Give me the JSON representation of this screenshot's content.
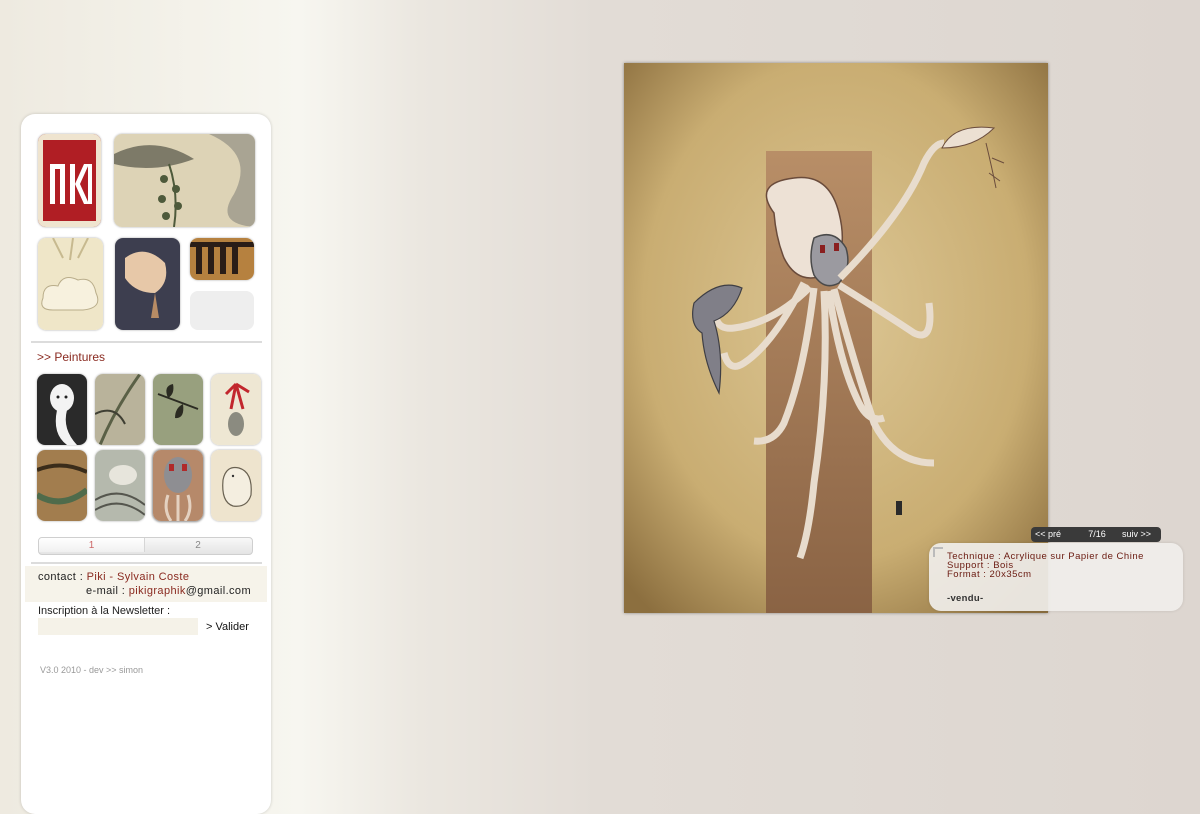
{
  "sidebar": {
    "section_link": ">> Peintures",
    "pagination": [
      "1",
      "2"
    ],
    "contact": {
      "label": "contact :",
      "name": "Piki - Sylvain Coste",
      "email_label": "e-mail :",
      "email_user": "pikigraphik",
      "email_domain": "@gmail.com"
    },
    "newsletter": {
      "label": "Inscription à la Newsletter :",
      "placeholder": "",
      "submit": "> Valider"
    },
    "footer": "V3.0 2010 - dev >> simon"
  },
  "viewer": {
    "prev": "<< pré",
    "counter": "7/16",
    "next": "suiv >>",
    "info": {
      "technique": "Technique : Acrylique sur Papier de Chine",
      "support": "Support : Bois",
      "format": "Format : 20x35cm",
      "status": "-vendu-"
    }
  },
  "colors": {
    "accent_red": "#8a2a20",
    "panel_bg": "#f6f3ea",
    "nav_bar": "#3a3a3a"
  }
}
